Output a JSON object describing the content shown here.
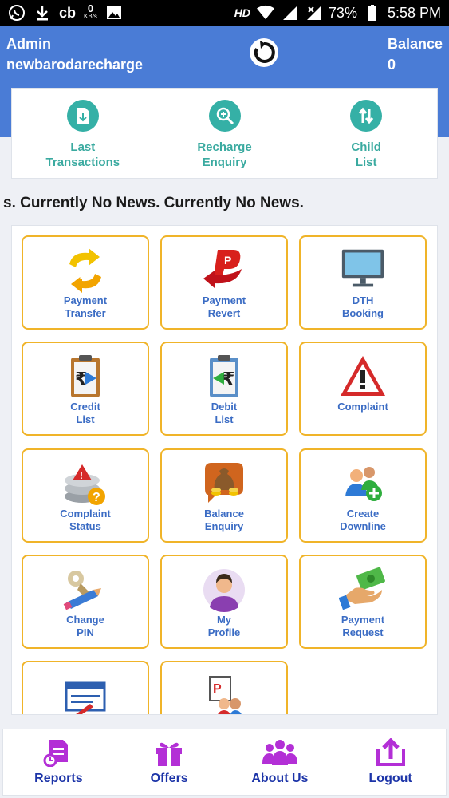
{
  "status_bar": {
    "carrier_text": "cb",
    "data_speed": "0",
    "data_unit": "KB/s",
    "hd_label": "HD",
    "battery": "73%",
    "time": "5:58 PM"
  },
  "header": {
    "user_role": "Admin",
    "username": "newbarodarecharge",
    "balance_label": "Balance",
    "balance_value": "0"
  },
  "quick_links": [
    {
      "label": "Last\nTransactions",
      "icon": "document-download-icon"
    },
    {
      "label": "Recharge\nEnquiry",
      "icon": "search-plus-icon"
    },
    {
      "label": "Child\nList",
      "icon": "up-down-arrows-icon"
    }
  ],
  "news_ticker": "s. Currently No News. Currently No News.",
  "tiles": [
    {
      "label": "Payment\nTransfer",
      "icon": "payment-transfer-icon"
    },
    {
      "label": "Payment\nRevert",
      "icon": "payment-revert-icon"
    },
    {
      "label": "DTH\nBooking",
      "icon": "monitor-icon"
    },
    {
      "label": "Credit\nList",
      "icon": "credit-clipboard-icon"
    },
    {
      "label": "Debit\nList",
      "icon": "debit-clipboard-icon"
    },
    {
      "label": "Complaint",
      "icon": "warning-icon"
    },
    {
      "label": "Complaint\nStatus",
      "icon": "complaint-status-icon"
    },
    {
      "label": "Balance\nEnquiry",
      "icon": "money-bag-icon"
    },
    {
      "label": "Create\nDownline",
      "icon": "add-users-icon"
    },
    {
      "label": "Change\nPIN",
      "icon": "key-pencil-icon"
    },
    {
      "label": "My\nProfile",
      "icon": "person-avatar-icon"
    },
    {
      "label": "Payment\nRequest",
      "icon": "hand-money-icon"
    },
    {
      "label": "",
      "icon": "form-pen-icon"
    },
    {
      "label": "",
      "icon": "users-report-icon"
    }
  ],
  "bottom_nav": [
    {
      "label": "Reports",
      "icon": "reports-icon"
    },
    {
      "label": "Offers",
      "icon": "gift-icon"
    },
    {
      "label": "About Us",
      "icon": "group-icon"
    },
    {
      "label": "Logout",
      "icon": "logout-icon"
    }
  ],
  "colors": {
    "header_blue": "#4a7cd6",
    "teal": "#35b0a6",
    "tile_border": "#f0b429",
    "tile_text": "#3b6cc4",
    "nav_icon_purple": "#b32fd6",
    "nav_text": "#1c34a8"
  }
}
